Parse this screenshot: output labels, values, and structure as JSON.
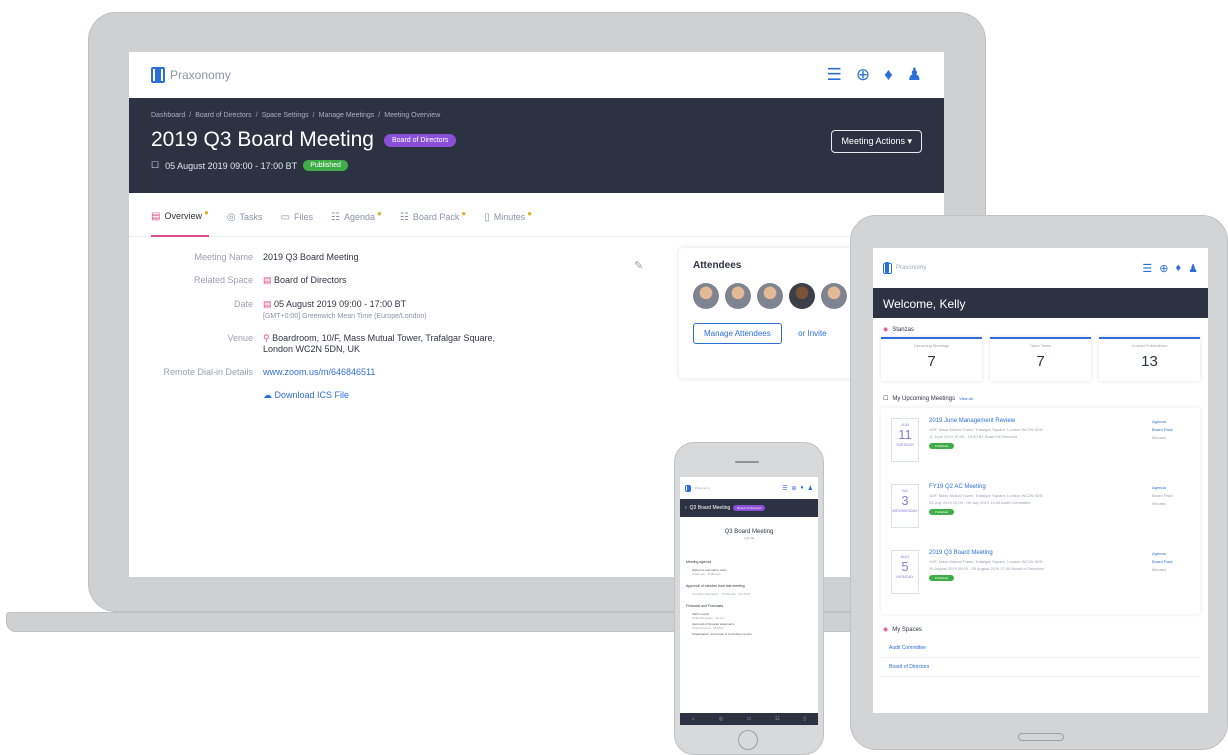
{
  "laptop": {
    "logo": "Praxonomy",
    "top_icons": [
      "menu-icon",
      "add-circle-icon",
      "bell-icon",
      "user-icon"
    ],
    "breadcrumb": [
      "Dashboard",
      "/",
      "Board of Directors",
      "/",
      "Space Settings",
      "/",
      "Manage Meetings",
      "/",
      "Meeting Overview"
    ],
    "title": "2019 Q3 Board Meeting",
    "space_badge": "Board of Directors",
    "date_line": "05 August 2019 09:00 - 17:00 BT",
    "status_badge": "Published",
    "actions_button": "Meeting Actions ▾",
    "tabs": [
      {
        "label": "Overview",
        "icon": "▤",
        "dot": "●"
      },
      {
        "label": "Tasks",
        "icon": "◎",
        "dot": ""
      },
      {
        "label": "Files",
        "icon": "▭",
        "dot": ""
      },
      {
        "label": "Agenda",
        "icon": "☷",
        "dot": "●"
      },
      {
        "label": "Board Pack",
        "icon": "☷",
        "dot": "●"
      },
      {
        "label": "Minutes",
        "icon": "▯",
        "dot": "●"
      }
    ],
    "details": {
      "meeting_name_label": "Meeting Name",
      "meeting_name": "2019 Q3 Board Meeting",
      "related_space_label": "Related Space",
      "related_space": "Board of Directors",
      "date_label": "Date",
      "date": "05 August 2019 09:00 - 17:00 BT",
      "timezone": "[GMT+0:00] Greenwich Mean Time (Europe/London)",
      "venue_label": "Venue",
      "venue": "Boardroom, 10/F, Mass Mutual Tower, Trafalgar Square, London WC2N 5DN, UK",
      "dialin_label": "Remote Dial-in Details",
      "dialin": "www.zoom.us/m/646846511",
      "download": "Download ICS File"
    },
    "attendees": {
      "title": "Attendees",
      "manage_button": "Manage Attendees",
      "invite": "or Invite"
    }
  },
  "tablet": {
    "logo": "Praxonomy",
    "welcome": "Welcome, Kelly",
    "stats_section": "Stanzas",
    "stats": [
      {
        "label": "Upcoming Meetings",
        "value": "7"
      },
      {
        "label": "Open Tasks",
        "value": "7"
      },
      {
        "label": "Unread Publications",
        "value": "13"
      }
    ],
    "meetings_title": "My Upcoming Meetings",
    "view_all": "View All",
    "meetings": [
      {
        "month": "JUN",
        "day": "11",
        "weekday": "TUESDAY",
        "name": "2019 June Management Review",
        "venue": "10/F, Mass Mutual Tower, Trafalgar Square, London WC2N 5DN",
        "time": "11 June 2019 10:00 - 15:00 BT  Board of Directors",
        "links": [
          "Agenda",
          "Board Pack",
          "Minutes"
        ]
      },
      {
        "month": "JUL",
        "day": "3",
        "weekday": "WEDNESDAY",
        "name": "FY19 Q2 AC Meeting",
        "venue": "10/F, Mass Mutual Tower, Trafalgar Square, London WC2N 5DN",
        "time": "03 July 2019 10:00 - 06 July 2019 13:00  Audit Committee",
        "links": [
          "Agenda",
          "Board Pack",
          "Minutes"
        ]
      },
      {
        "month": "AUG",
        "day": "5",
        "weekday": "MONDAY",
        "name": "2019 Q3 Board Meeting",
        "venue": "10/F, Mass Mutual Tower, Trafalgar Square, London WC2N 5DN",
        "time": "05 August 2019 09:00 - 05 August 2019 17:00  Board of Directors",
        "links": [
          "Agenda",
          "Board Pack",
          "Minutes"
        ]
      }
    ],
    "published": "Published",
    "spaces_title": "My Spaces",
    "spaces": [
      "Audit Committee",
      "Board of Directors"
    ]
  },
  "phone": {
    "logo": "Praxonomy",
    "header": "Q3 Board Meeting",
    "header_badge": "Board of Directors",
    "title": "Q3 Board Meeting",
    "subtitle": "Agenda",
    "sections": [
      {
        "heading": "Meeting agenda",
        "items": [
          {
            "t": "Welcome and call to order",
            "s": "Chairman · 5 Minutes"
          }
        ]
      },
      {
        "heading": "Approval of minutes from last meeting",
        "items": [
          {
            "t": "Company Secretary · 10 Minutes · Q1 2019",
            "s": ""
          }
        ]
      },
      {
        "heading": "Financial and Forecasts",
        "items": [
          {
            "t": "CEO's report",
            "s": "Chief Executive · 15 min"
          },
          {
            "t": "Approval of financial statements",
            "s": "Chief Finance · 15 Mins"
          },
          {
            "t": "Organisation restructure & committee reports",
            "s": ""
          }
        ]
      }
    ]
  }
}
